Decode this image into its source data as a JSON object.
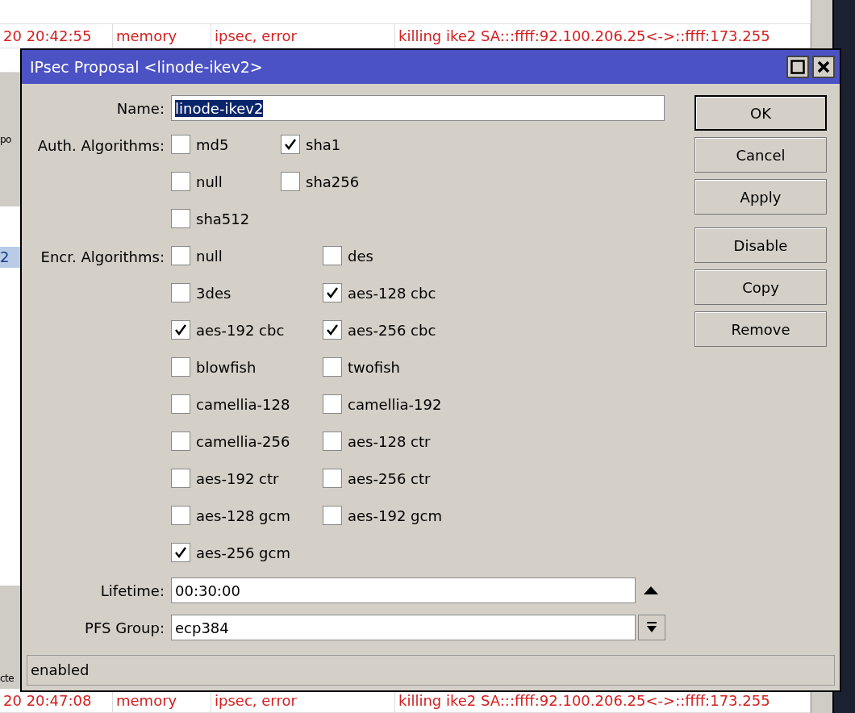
{
  "log_top": [
    {
      "time": "20 20:42:55",
      "topic": "memory",
      "topics": "ipsec, error",
      "message": "killing ike2 SA:::ffff:92.100.206.25<->::ffff:173.255"
    }
  ],
  "background_window": {
    "fragments": [
      "po",
      "2",
      "cte"
    ]
  },
  "log_bottom": [
    {
      "time": "20 20:47:08",
      "topic": "memory",
      "topics": "ipsec, error",
      "message": "killing ike2 SA:::ffff:92.100.206.25<->::ffff:173.255"
    }
  ],
  "dialog": {
    "title": "IPsec Proposal <linode-ikev2>",
    "name": {
      "label": "Name:",
      "value": "linode-ikev2",
      "highlighted": true
    },
    "auth": {
      "label": "Auth. Algorithms:",
      "options": [
        {
          "label": "md5",
          "checked": false
        },
        {
          "label": "sha1",
          "checked": true
        },
        {
          "label": "null",
          "checked": false
        },
        {
          "label": "sha256",
          "checked": false
        },
        {
          "label": "sha512",
          "checked": false
        }
      ]
    },
    "encr": {
      "label": "Encr. Algorithms:",
      "options": [
        {
          "label": "null",
          "checked": false
        },
        {
          "label": "des",
          "checked": false
        },
        {
          "label": "3des",
          "checked": false
        },
        {
          "label": "aes-128 cbc",
          "checked": true
        },
        {
          "label": "aes-192 cbc",
          "checked": true
        },
        {
          "label": "aes-256 cbc",
          "checked": true
        },
        {
          "label": "blowfish",
          "checked": false
        },
        {
          "label": "twofish",
          "checked": false
        },
        {
          "label": "camellia-128",
          "checked": false
        },
        {
          "label": "camellia-192",
          "checked": false
        },
        {
          "label": "camellia-256",
          "checked": false
        },
        {
          "label": "aes-128 ctr",
          "checked": false
        },
        {
          "label": "aes-192 ctr",
          "checked": false
        },
        {
          "label": "aes-256 ctr",
          "checked": false
        },
        {
          "label": "aes-128 gcm",
          "checked": false
        },
        {
          "label": "aes-192 gcm",
          "checked": false
        },
        {
          "label": "aes-256 gcm",
          "checked": true
        }
      ]
    },
    "lifetime": {
      "label": "Lifetime:",
      "value": "00:30:00"
    },
    "pfs_group": {
      "label": "PFS Group:",
      "value": "ecp384"
    },
    "button_groups": [
      [
        {
          "label": "OK",
          "default": true
        },
        {
          "label": "Cancel",
          "default": false
        },
        {
          "label": "Apply",
          "default": false
        }
      ],
      [
        {
          "label": "Disable",
          "default": false
        },
        {
          "label": "Copy",
          "default": false
        },
        {
          "label": "Remove",
          "default": false
        }
      ]
    ],
    "status": "enabled"
  }
}
